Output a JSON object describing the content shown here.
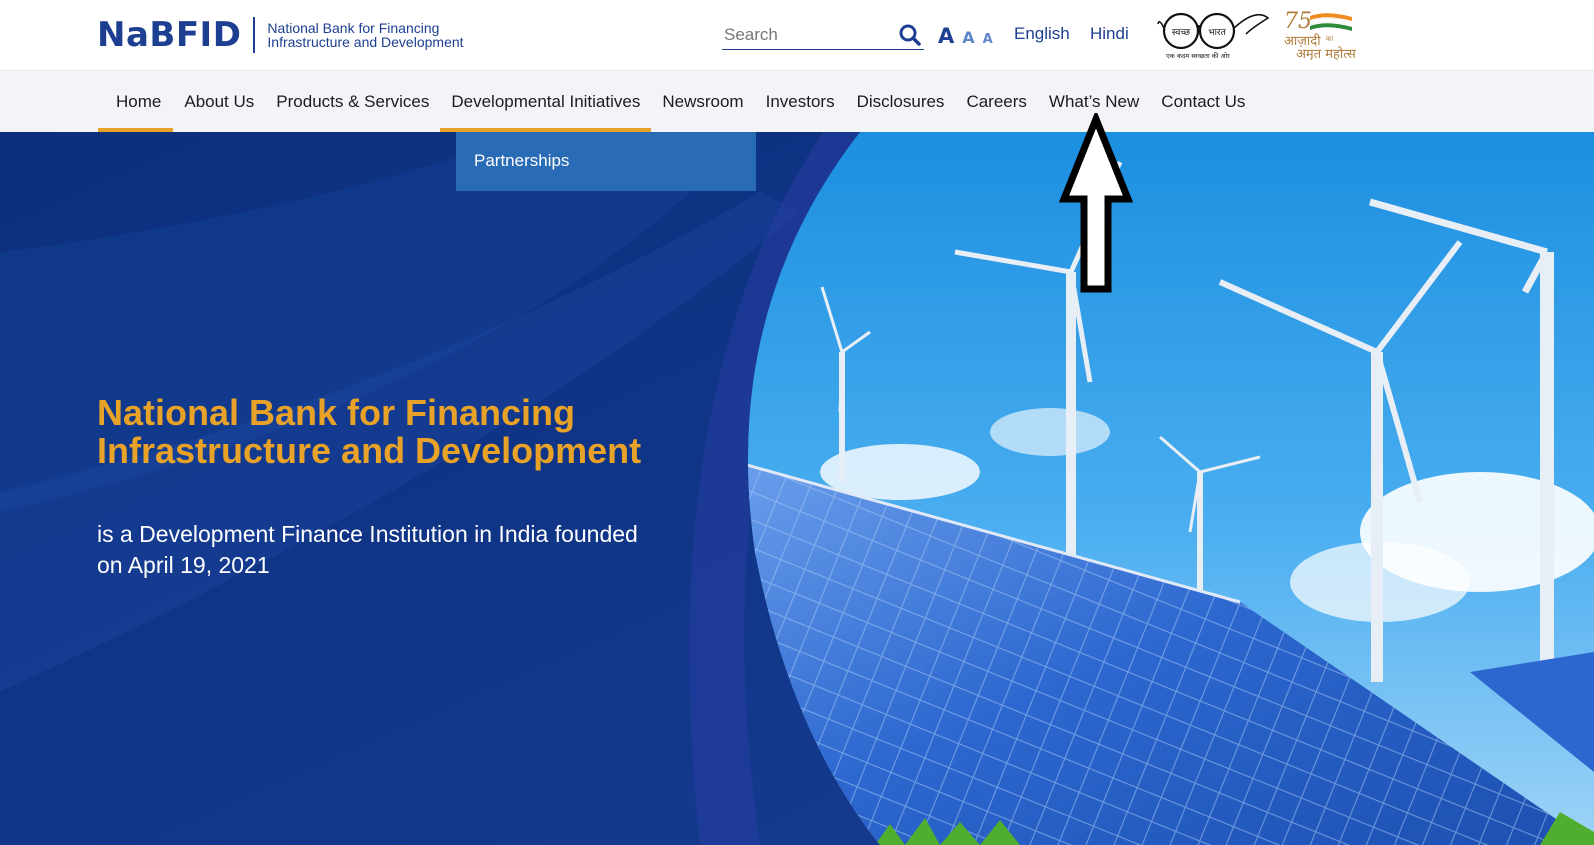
{
  "header": {
    "logo_text": "NaBFID",
    "logo_sub_line1": "National Bank for Financing",
    "logo_sub_line2": "Infrastructure and Development",
    "search_placeholder": "Search",
    "font_sizes": [
      "A",
      "A",
      "A"
    ],
    "languages": [
      "English",
      "Hindi"
    ],
    "swachh_text": "स्वच्छ",
    "bharat_text": "भारत",
    "swachh_tagline": "एक कदम स्वच्छता की ओर",
    "azadi_number": "75",
    "azadi_line1": "आज़ादी",
    "azadi_ka": "का",
    "azadi_line2": "अमृत महोत्सव"
  },
  "nav": {
    "items": [
      "Home",
      "About Us",
      "Products & Services",
      "Developmental Initiatives",
      "Newsroom",
      "Investors",
      "Disclosures",
      "Careers",
      "What’s New",
      "Contact Us"
    ],
    "active_index": 0,
    "open_index": 3
  },
  "dropdown": {
    "items": [
      "Partnerships"
    ]
  },
  "hero": {
    "title": "National Bank for Financing Infrastructure and Development",
    "subtitle": "is a Development Finance Institution in India founded on April 19, 2021"
  },
  "colors": {
    "brand_blue": "#1d3f91",
    "accent_orange": "#e8a228",
    "hero_blue": "#123b8e",
    "dropdown_blue": "#2a6bb6",
    "nav_bg": "#f2f4f8"
  },
  "icons": {
    "search": "search-icon",
    "annotation": "up-arrow-icon"
  }
}
